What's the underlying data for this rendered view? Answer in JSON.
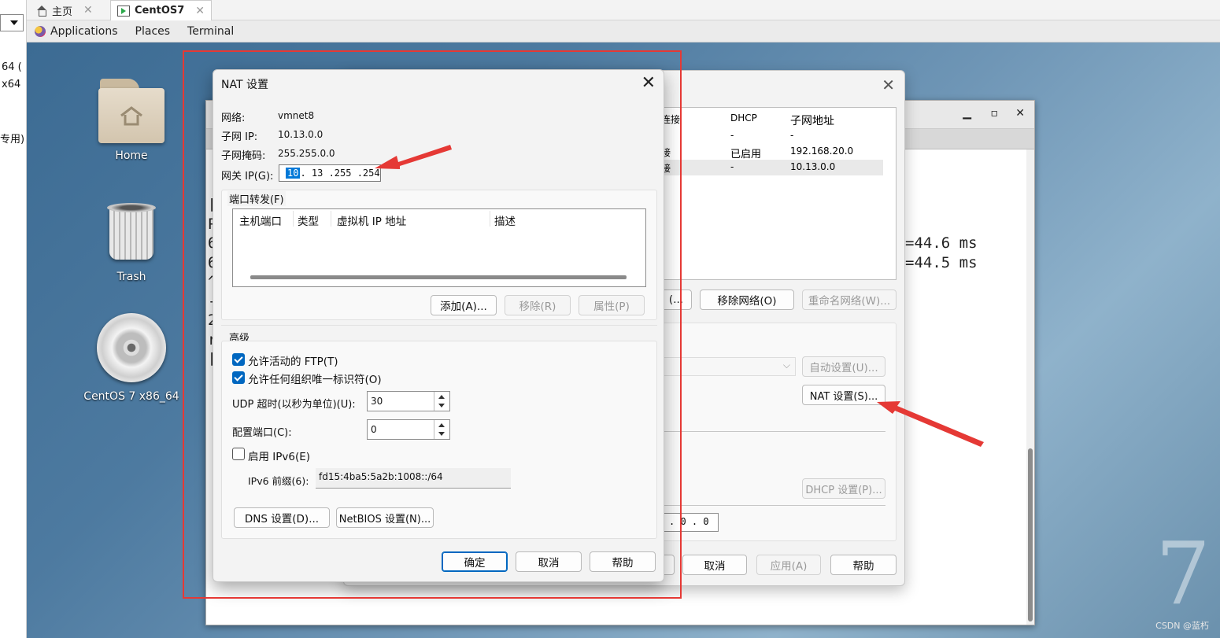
{
  "host": {
    "sidebar_texts": [
      "64 (",
      "x64",
      "专用)"
    ],
    "tabs": [
      {
        "label": "主页"
      },
      {
        "label": "CentOS7"
      }
    ]
  },
  "panel": {
    "applications": "Applications",
    "places": "Places",
    "terminal": "Terminal"
  },
  "desktop": {
    "icons": [
      {
        "label": "Home",
        "icon": "home-folder-icon"
      },
      {
        "label": "Trash",
        "icon": "trash-icon"
      },
      {
        "label": "CentOS 7 x86_64",
        "icon": "cd-icon"
      }
    ],
    "brand_digit": "7",
    "watermark": "CSDN @蓝朽"
  },
  "terminal": {
    "left_chars": [
      "[",
      "P",
      "6",
      "6",
      "^",
      "-",
      "2",
      "r",
      "["
    ],
    "ping_lines": [
      "=44.6 ms",
      "=44.5 ms"
    ]
  },
  "network_editor": {
    "table_headers": [
      "连接",
      "DHCP",
      "子网地址"
    ],
    "rows": [
      {
        "conn": "-",
        "dhcp": "-",
        "subnet": "-"
      },
      {
        "conn": "接",
        "dhcp": "已启用",
        "subnet": "192.168.20.0"
      },
      {
        "conn": "接",
        "dhcp": "-",
        "subnet": "10.13.0.0"
      }
    ],
    "btn_partial": "(...",
    "btn_remove_network": "移除网络(O)",
    "btn_rename_network": "重命名网络(W)...",
    "btn_auto_settings": "自动设置(U)...",
    "btn_nat_settings": "NAT 设置(S)...",
    "btn_dhcp_settings": "DHCP 设置(P)...",
    "ip_tail": ". 0 . 0",
    "btn_cancel": "取消",
    "btn_apply": "应用(A)",
    "btn_help": "帮助"
  },
  "nat": {
    "title": "NAT 设置",
    "network_label": "网络:",
    "network_value": "vmnet8",
    "subnet_ip_label": "子网 IP:",
    "subnet_ip_value": "10.13.0.0",
    "subnet_mask_label": "子网掩码:",
    "subnet_mask_value": "255.255.0.0",
    "gateway_label": "网关 IP(G):",
    "gateway_first": "10",
    "gateway_rest": " . 13 .255 .254",
    "port_forward_label": "端口转发(F)",
    "columns": [
      "主机端口",
      "类型",
      "虚拟机 IP 地址",
      "描述"
    ],
    "btn_add": "添加(A)...",
    "btn_remove": "移除(R)",
    "btn_properties": "属性(P)",
    "advanced_label": "高级",
    "allow_ftp": {
      "label": "允许活动的 FTP(T)",
      "checked": true
    },
    "allow_oui": {
      "label": "允许任何组织唯一标识符(O)",
      "checked": true
    },
    "udp_timeout_label": "UDP 超时(以秒为单位)(U):",
    "udp_timeout_value": "30",
    "config_port_label": "配置端口(C):",
    "config_port_value": "0",
    "enable_ipv6": {
      "label": "启用 IPv6(E)",
      "checked": false
    },
    "ipv6_prefix_label": "IPv6 前缀(6):",
    "ipv6_prefix_value": "fd15:4ba5:5a2b:1008::/64",
    "btn_dns": "DNS 设置(D)...",
    "btn_netbios": "NetBIOS 设置(N)...",
    "btn_ok": "确定",
    "btn_cancel": "取消",
    "btn_help": "帮助"
  },
  "colors": {
    "annotation_red": "#e53935",
    "accent_blue": "#0067c0"
  }
}
